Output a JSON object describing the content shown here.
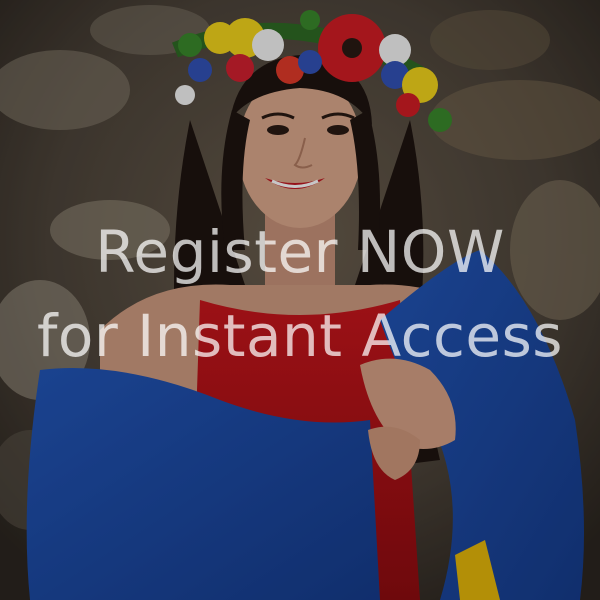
{
  "promo": {
    "line1": "Register NOW",
    "line2": "for Instant Access"
  },
  "colors": {
    "dress": "#b81218",
    "flag_blue": "#1c4aa8",
    "flag_yellow": "#e6b80a",
    "background_rock": "#5b5246",
    "hair": "#1e1410",
    "skin": "#d9a58a",
    "cta_text": "rgba(255,255,255,0.72)"
  },
  "icons": {
    "flower_crown": "flower-crown-icon"
  }
}
